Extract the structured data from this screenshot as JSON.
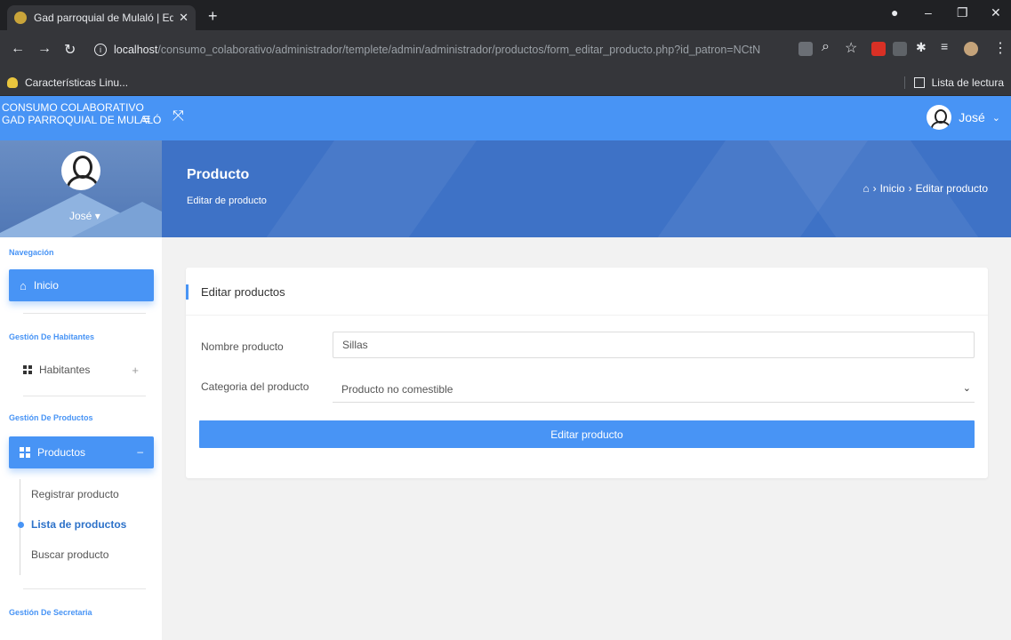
{
  "browser": {
    "tab_title": "Gad parroquial de Mulaló | Editar",
    "tab_close": "✕",
    "new_tab": "+",
    "url_host": "localhost",
    "url_path": "/consumo_colaborativo/administrador/templete/admin/administrador/productos/form_editar_producto.php?id_patron=NCtN",
    "bookmark": "Características Linu...",
    "reading_list": "Lista de lectura"
  },
  "header": {
    "brand_line1": "CONSUMO COLABORATIVO",
    "brand_line2": "GAD PARROQUIAL DE MULALÓ",
    "user_name": "José"
  },
  "banner": {
    "side_user": "José",
    "title": "Producto",
    "subtitle": "Editar de producto",
    "breadcrumb_home": "Inicio",
    "breadcrumb_current": "Editar producto"
  },
  "sidebar": {
    "nav_title": "Navegación",
    "inicio": "Inicio",
    "habitantes_title": "Gestión De Habitantes",
    "habitantes": "Habitantes",
    "productos_title": "Gestión De Productos",
    "productos": "Productos",
    "sub_items": [
      "Registrar producto",
      "Lista de productos",
      "Buscar producto"
    ],
    "secretaria_title": "Gestión De Secretaria"
  },
  "form": {
    "card_title": "Editar productos",
    "name_label": "Nombre producto",
    "name_value": "Sillas",
    "category_label": "Categoria del producto",
    "category_value": "Producto no comestible",
    "submit": "Editar producto"
  },
  "colors": {
    "accent": "#4894f5",
    "banner": "#3e72c6"
  }
}
